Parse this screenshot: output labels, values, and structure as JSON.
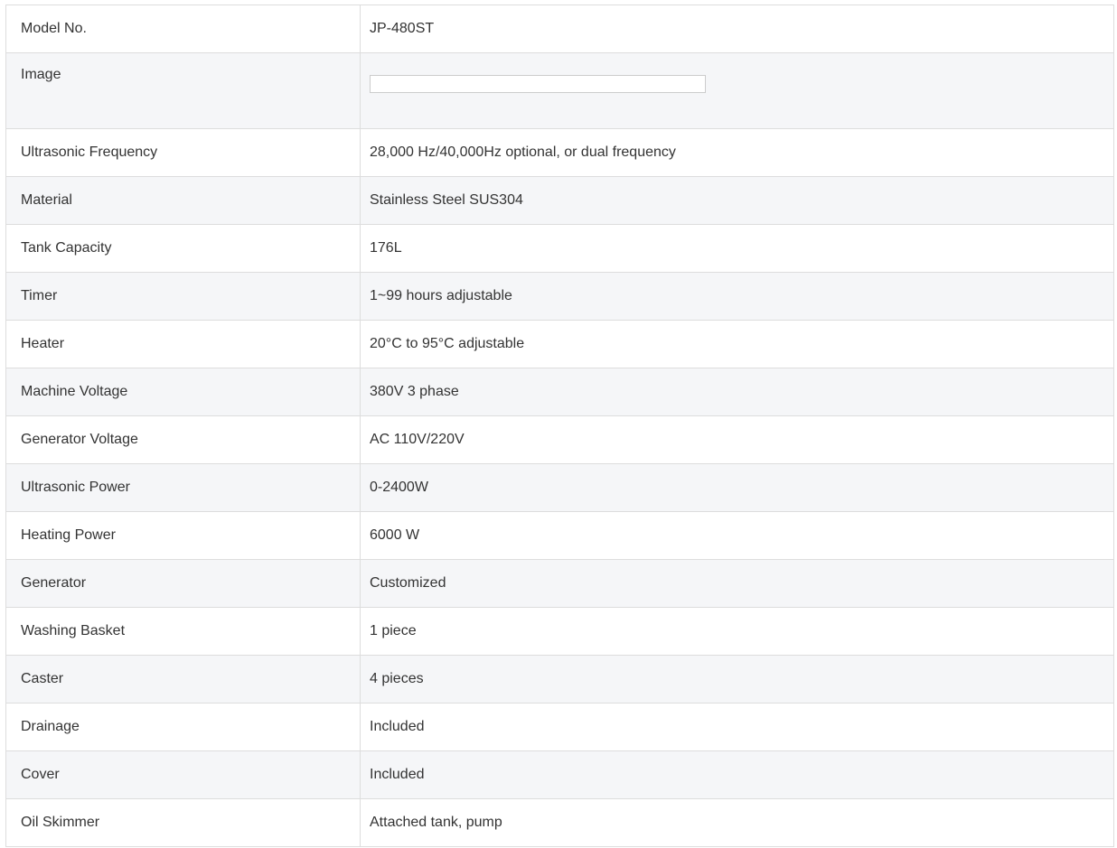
{
  "specs": {
    "rows": [
      {
        "label": "Model No.",
        "value": "JP-480ST"
      },
      {
        "label": "Image",
        "value": ""
      },
      {
        "label": "Ultrasonic Frequency",
        "value": "28,000 Hz/40,000Hz optional, or dual frequency"
      },
      {
        "label": "Material",
        "value": "Stainless Steel SUS304"
      },
      {
        "label": "Tank Capacity",
        "value": "176L"
      },
      {
        "label": "Timer",
        "value": "1~99 hours adjustable"
      },
      {
        "label": "Heater",
        "value": "20°C to 95°C adjustable"
      },
      {
        "label": "Machine Voltage",
        "value": "380V 3 phase"
      },
      {
        "label": "Generator Voltage",
        "value": "AC 110V/220V"
      },
      {
        "label": "Ultrasonic Power",
        "value": "0-2400W"
      },
      {
        "label": "Heating Power",
        "value": "6000 W"
      },
      {
        "label": "Generator",
        "value": "Customized"
      },
      {
        "label": "Washing Basket",
        "value": "1 piece"
      },
      {
        "label": "Caster",
        "value": "4 pieces"
      },
      {
        "label": "Drainage",
        "value": "Included"
      },
      {
        "label": "Cover",
        "value": "Included"
      },
      {
        "label": "Oil Skimmer",
        "value": "Attached tank, pump"
      }
    ]
  },
  "colors": {
    "text": "#333333",
    "border": "#dddddd",
    "stripe": "#f5f6f8"
  }
}
